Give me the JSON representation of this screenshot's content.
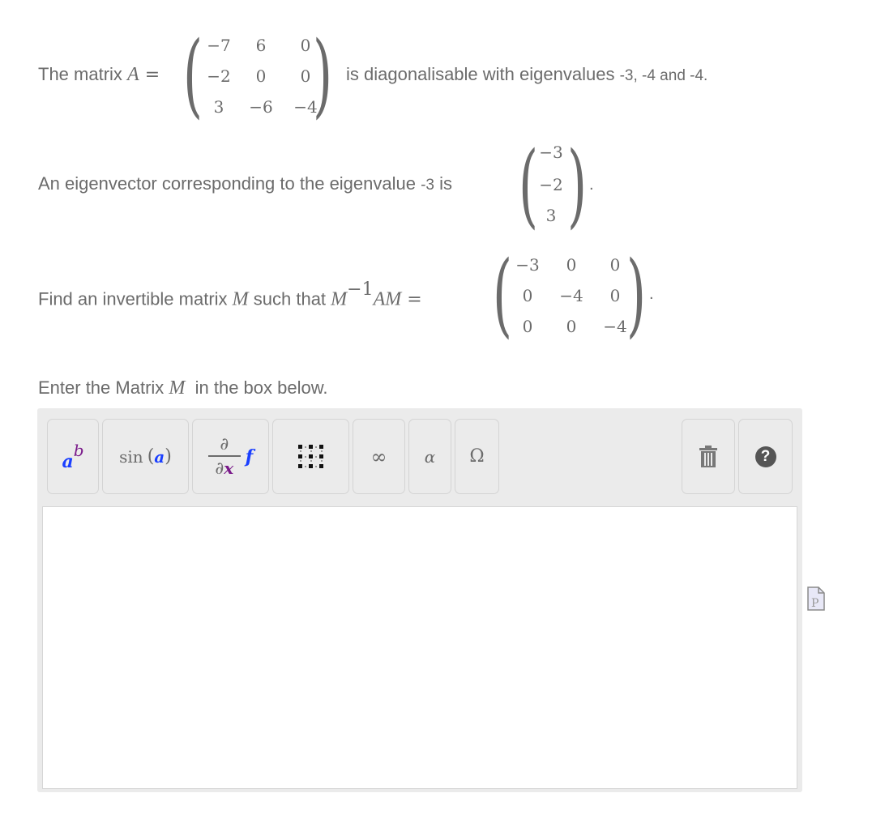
{
  "q1": {
    "prefix": "The matrix ",
    "var": "A",
    "eq": " =",
    "matrix": [
      [
        "−7",
        "6",
        "0"
      ],
      [
        "−2",
        "0",
        "0"
      ],
      [
        "3",
        "−6",
        "−4"
      ]
    ],
    "suffix_main": "is diagonalisable with eigenvalues ",
    "eigenvalues_text": "-3, -4 and -4."
  },
  "q2": {
    "prefix": "An eigenvector corresponding to the eigenvalue ",
    "eigenvalue": "-3",
    "is": " is",
    "vector": [
      "−3",
      "−2",
      "3"
    ],
    "period": "."
  },
  "q3": {
    "prefix": "Find an invertible matrix ",
    "var": "M",
    "mid": " such that ",
    "lhs_m": "M",
    "lhs_exp": "−1",
    "lhs_am": "AM",
    "eq": " =",
    "matrix": [
      [
        "−3",
        "0",
        "0"
      ],
      [
        "0",
        "−4",
        "0"
      ],
      [
        "0",
        "0",
        "−4"
      ]
    ],
    "period": "."
  },
  "instruction": {
    "prefix": "Enter the Matrix ",
    "var": "M",
    "suffix": "  in the box below."
  },
  "toolbar": {
    "power": {
      "base": "a",
      "exp": "b"
    },
    "trig": {
      "fn": "sin",
      "lparen": "(",
      "arg": "a",
      "rparen": ")"
    },
    "derivative": {
      "num": "∂",
      "den_d": "∂",
      "den_var": "x",
      "func": "f"
    },
    "infinity": "∞",
    "alpha": "α",
    "omega": "Ω",
    "help": "?"
  },
  "editor": {
    "value": ""
  },
  "colors": {
    "blue": "#1a3fff",
    "purple": "#7a1a8a",
    "text": "#6b6b6b",
    "panel": "#ebebeb"
  }
}
